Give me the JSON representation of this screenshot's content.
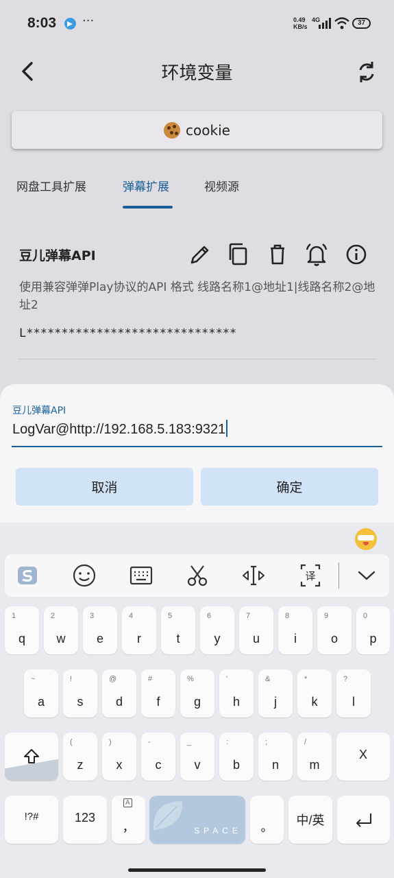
{
  "status_bar": {
    "time": "8:03",
    "more": "···",
    "net_speed_value": "0.49",
    "net_speed_unit": "KB/s",
    "network": "4G",
    "battery": "37"
  },
  "app_bar": {
    "title": "环境变量"
  },
  "cookie_button": {
    "label": "cookie"
  },
  "tabs": [
    {
      "label": "网盘工具扩展"
    },
    {
      "label": "弹幕扩展",
      "active": true
    },
    {
      "label": "视频源"
    }
  ],
  "item": {
    "title": "豆儿弹幕API",
    "description": "使用兼容弹弹Play协议的API 格式 线路名称1@地址1|线路名称2@地址2",
    "value": "L******************************"
  },
  "dialog": {
    "field_label": "豆儿弹幕API",
    "field_value": "LogVar@http://192.168.5.183:9321",
    "cancel_label": "取消",
    "confirm_label": "确定"
  },
  "keyboard": {
    "row1": [
      {
        "hint": "1",
        "ch": "q"
      },
      {
        "hint": "2",
        "ch": "w"
      },
      {
        "hint": "3",
        "ch": "e"
      },
      {
        "hint": "4",
        "ch": "r"
      },
      {
        "hint": "5",
        "ch": "t"
      },
      {
        "hint": "6",
        "ch": "y"
      },
      {
        "hint": "7",
        "ch": "u"
      },
      {
        "hint": "8",
        "ch": "i"
      },
      {
        "hint": "9",
        "ch": "o"
      },
      {
        "hint": "0",
        "ch": "p"
      }
    ],
    "row2": [
      {
        "hint": "~",
        "ch": "a"
      },
      {
        "hint": "!",
        "ch": "s"
      },
      {
        "hint": "@",
        "ch": "d"
      },
      {
        "hint": "#",
        "ch": "f"
      },
      {
        "hint": "%",
        "ch": "g"
      },
      {
        "hint": "'",
        "ch": "h"
      },
      {
        "hint": "&",
        "ch": "j"
      },
      {
        "hint": "*",
        "ch": "k"
      },
      {
        "hint": "?",
        "ch": "l"
      }
    ],
    "row3": [
      {
        "hint": "(",
        "ch": "z"
      },
      {
        "hint": ")",
        "ch": "x"
      },
      {
        "hint": "-",
        "ch": "c"
      },
      {
        "hint": "_",
        "ch": "v"
      },
      {
        "hint": ":",
        "ch": "b"
      },
      {
        "hint": ";",
        "ch": "n"
      },
      {
        "hint": "/",
        "ch": "m"
      }
    ],
    "delete_label": "X",
    "symbols_label": "!?#",
    "numbers_label": "123",
    "comma_label": "，",
    "space_label": "SPACE",
    "period_label": "。",
    "lang_label": "中/英"
  }
}
